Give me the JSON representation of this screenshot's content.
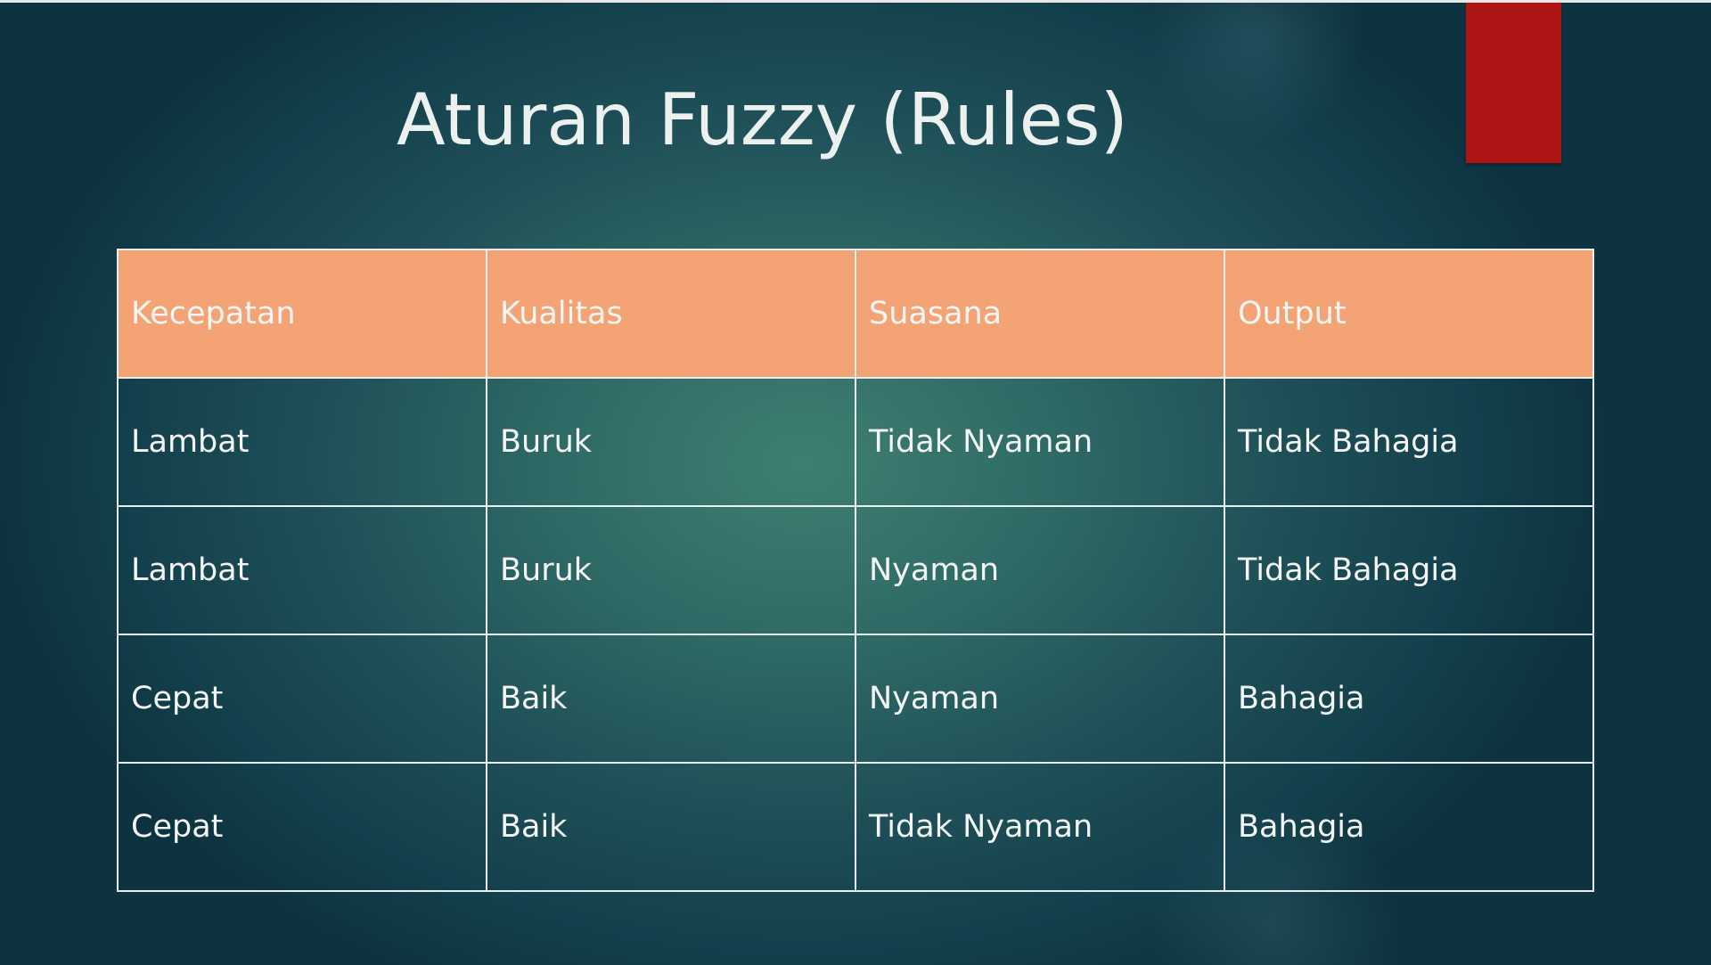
{
  "slide": {
    "title": "Aturan Fuzzy (Rules)",
    "colors": {
      "background": "#2f6b66",
      "header_fill": "#f4a374",
      "accent_bar": "#ad1515",
      "text": "#f4f6f5",
      "grid_lines": "#e9efee"
    }
  },
  "table": {
    "headers": [
      "Kecepatan",
      "Kualitas",
      "Suasana",
      "Output"
    ],
    "rows": [
      [
        "Lambat",
        "Buruk",
        "Tidak Nyaman",
        "Tidak Bahagia"
      ],
      [
        "Lambat",
        "Buruk",
        "Nyaman",
        "Tidak Bahagia"
      ],
      [
        "Cepat",
        "Baik",
        "Nyaman",
        "Bahagia"
      ],
      [
        "Cepat",
        "Baik",
        "Tidak Nyaman",
        "Bahagia"
      ]
    ]
  }
}
